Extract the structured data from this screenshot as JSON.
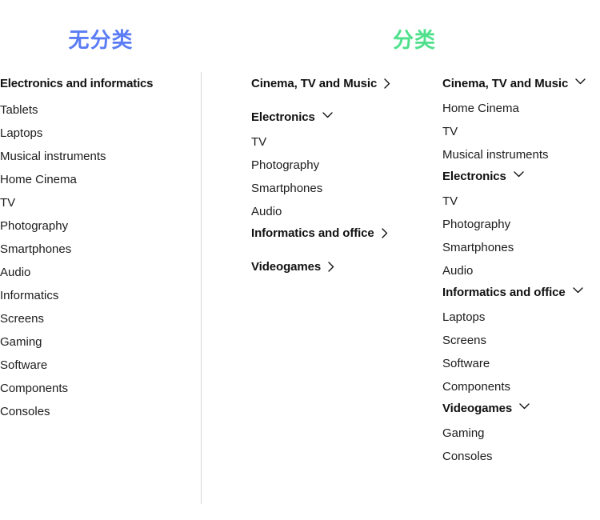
{
  "titles": {
    "left": "无分类",
    "right": "分类",
    "left_color": "#5B7CF5",
    "right_color": "#4FE08C"
  },
  "divider": {
    "color": "#d8d8d8"
  },
  "flat_column": {
    "heading": "Electronics and informatics",
    "items": [
      "Tablets",
      "Laptops",
      "Musical instruments",
      "Home Cinema",
      "TV",
      "Photography",
      "Smartphones",
      "Audio",
      "Informatics",
      "Screens",
      "Gaming",
      "Software",
      "Components",
      "Consoles"
    ]
  },
  "middle_column": {
    "groups": [
      {
        "label": "Cinema, TV and Music",
        "state": "collapsed",
        "icon": "chevron-right-icon",
        "items": []
      },
      {
        "label": "Electronics",
        "state": "expanded",
        "icon": "chevron-down-icon",
        "items": [
          "TV",
          "Photography",
          "Smartphones",
          "Audio"
        ]
      },
      {
        "label": "Informatics and office",
        "state": "collapsed",
        "icon": "chevron-right-icon",
        "items": []
      },
      {
        "label": "Videogames",
        "state": "collapsed",
        "icon": "chevron-right-icon",
        "items": []
      }
    ]
  },
  "right_column": {
    "groups": [
      {
        "label": "Cinema, TV and Music",
        "state": "expanded",
        "icon": "chevron-down-icon",
        "items": [
          "Home Cinema",
          "TV",
          "Musical instruments"
        ]
      },
      {
        "label": "Electronics",
        "state": "expanded",
        "icon": "chevron-down-icon",
        "items": [
          "TV",
          "Photography",
          "Smartphones",
          "Audio"
        ]
      },
      {
        "label": "Informatics and office",
        "state": "expanded",
        "icon": "chevron-down-icon",
        "items": [
          "Laptops",
          "Screens",
          "Software",
          "Components"
        ]
      },
      {
        "label": "Videogames",
        "state": "expanded",
        "icon": "chevron-down-icon",
        "items": [
          "Gaming",
          "Consoles"
        ]
      }
    ]
  }
}
